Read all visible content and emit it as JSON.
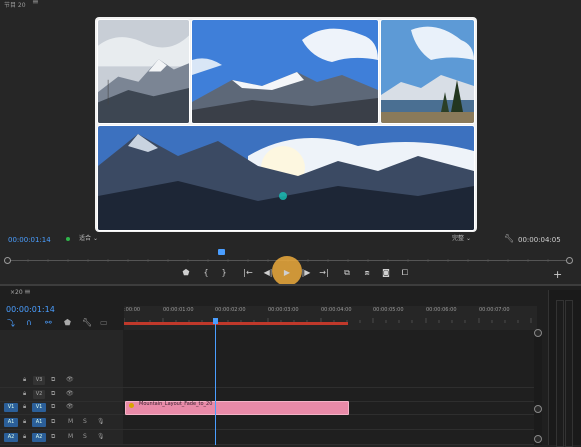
{
  "monitor": {
    "tab_title": "节目 20",
    "menu_icon": "≡",
    "timecode_current": "00:00:01:14",
    "fit_label": "适合",
    "resolution_label": "完整",
    "timecode_duration": "00:00:04:05",
    "photos": [
      {
        "name": "snowy-peak-cloudy"
      },
      {
        "name": "snow-ridge-blue-sky"
      },
      {
        "name": "lake-pine-mountain"
      },
      {
        "name": "mountain-range-sunburst"
      }
    ],
    "controls": [
      "marker-icon",
      "mark-in-icon",
      "mark-out-icon",
      "go-to-in-icon",
      "step-back-icon",
      "play-icon",
      "step-forward-icon",
      "go-to-out-icon",
      "lift-icon",
      "extract-icon",
      "export-frame-icon",
      "compare-icon"
    ],
    "add_label": "+"
  },
  "timeline": {
    "tab_title": "20",
    "close_label": "×",
    "menu_icon": "≡",
    "timecode": "00:00:01:14",
    "ruler_ticks": [
      ":00:00",
      "00:00:01:00",
      "00:00:02:00",
      "00:00:03:00",
      "00:00:04:00",
      "00:00:05:00",
      "00:00:06:00",
      "00:00:07:00"
    ],
    "tracks": [
      {
        "src": "",
        "name": "V3"
      },
      {
        "src": "",
        "name": "V2"
      },
      {
        "src": "V1",
        "name": "V1"
      },
      {
        "src": "A1",
        "name": "A1",
        "m": "M",
        "s": "S"
      },
      {
        "src": "A2",
        "name": "A2",
        "m": "M",
        "s": "S"
      }
    ],
    "clip": {
      "name": "Mountain_Layout_Fade_to_20",
      "track": "V1",
      "color": "#e98aa8"
    }
  },
  "colors": {
    "accent": "#4a9eff",
    "workarea": "#c0392b",
    "clip": "#e98aa8",
    "cursor": "#ecaa3c"
  }
}
